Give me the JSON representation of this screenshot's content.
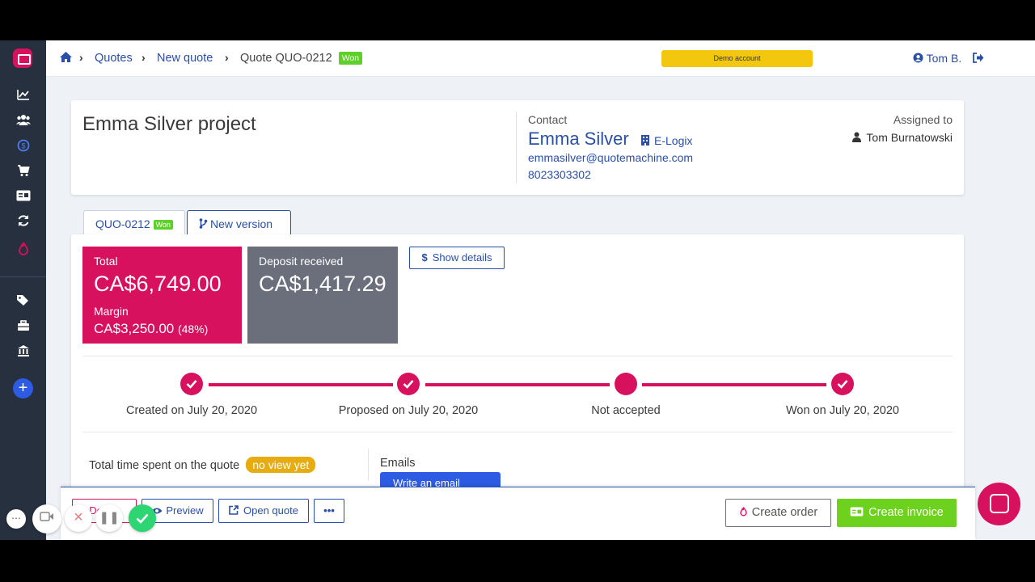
{
  "topbar": {
    "breadcrumb": [
      "Quotes",
      "New quote"
    ],
    "current_page": "Quote QUO-0212",
    "status_badge": "Won",
    "demo_banner": "Demo account",
    "user_name": "Tom B."
  },
  "project": {
    "title": "Emma Silver project",
    "contact_label": "Contact",
    "contact_name": "Emma Silver",
    "company": "E-Logix",
    "email": "emmasilver@quotemachine.com",
    "phone": "8023303302",
    "assigned_label": "Assigned to",
    "assigned_name": "Tom Burnatowski"
  },
  "tabs": {
    "quote_label": "QUO-0212",
    "quote_badge": "Won",
    "new_version": "New version"
  },
  "summary": {
    "total_label": "Total",
    "total_value": "CA$6,749.00",
    "margin_label": "Margin",
    "margin_value": "CA$3,250.00",
    "margin_pct": "(48%)",
    "deposit_label": "Deposit received",
    "deposit_value": "CA$1,417.29",
    "show_details": "Show details"
  },
  "timeline": [
    {
      "label": "Created on July 20, 2020",
      "done": true
    },
    {
      "label": "Proposed on July 20, 2020",
      "done": true
    },
    {
      "label": "Not accepted",
      "done": false
    },
    {
      "label": "Won on July 20, 2020",
      "done": true
    }
  ],
  "activity": {
    "time_spent_label": "Total time spent on the quote",
    "time_spent_badge": "no view yet",
    "emails_label": "Emails",
    "write_email": "Write an email"
  },
  "actions": {
    "delete": "Delete",
    "preview": "Preview",
    "open_quote": "Open quote",
    "more": "•••",
    "create_order": "Create order",
    "create_invoice": "Create invoice"
  },
  "colors": {
    "accent": "#d8115e",
    "link": "#2a4fa8",
    "success": "#6dd21e",
    "sidebar": "#26303e"
  }
}
